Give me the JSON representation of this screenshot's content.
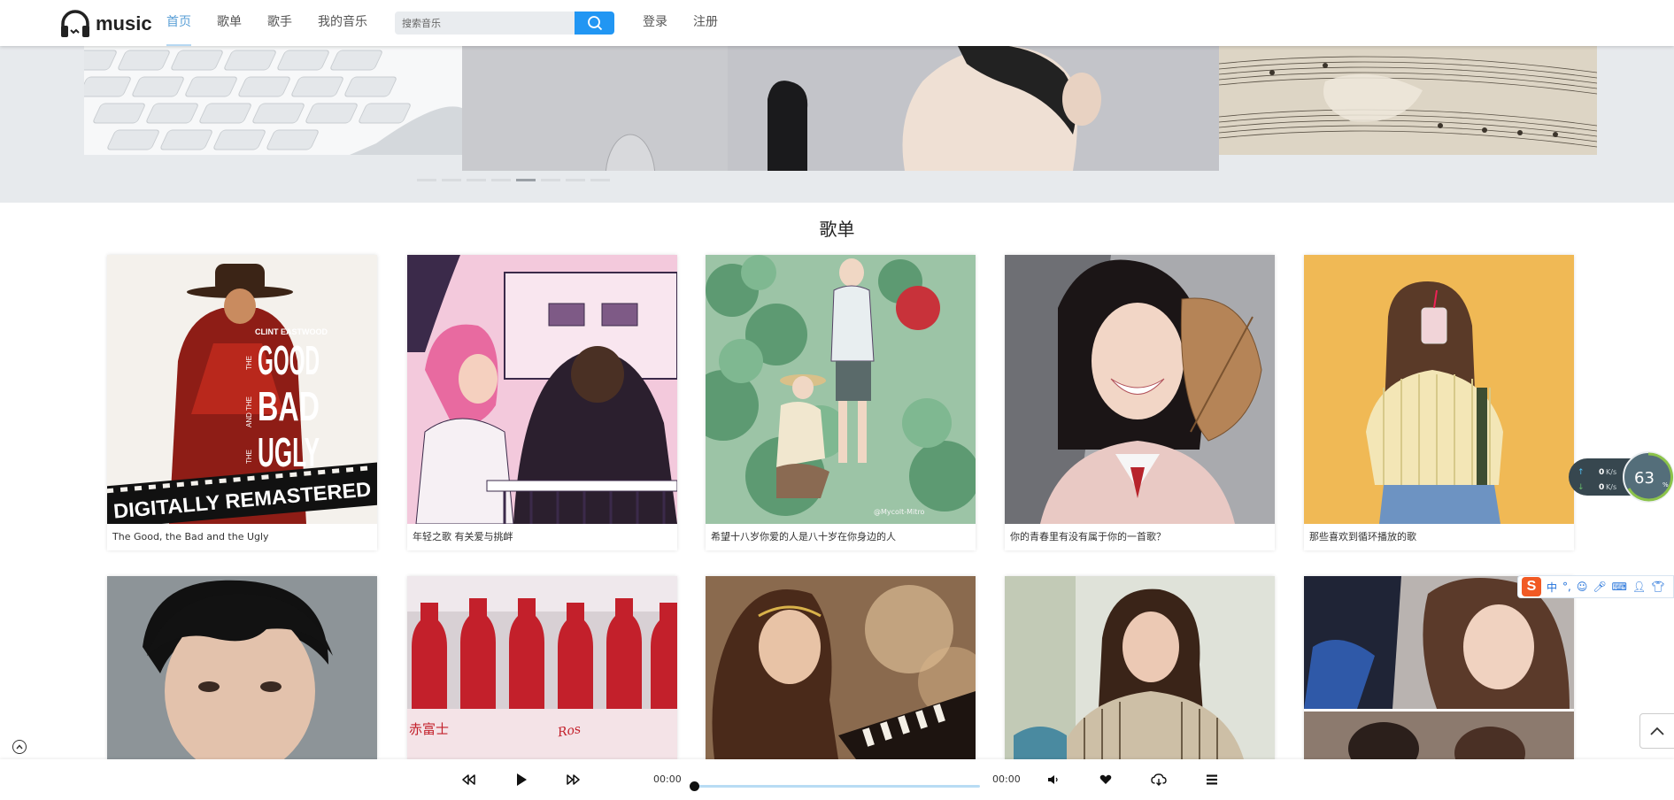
{
  "header": {
    "logo_text": "music",
    "nav": [
      {
        "label": "首页",
        "active": true
      },
      {
        "label": "歌单",
        "active": false
      },
      {
        "label": "歌手",
        "active": false
      },
      {
        "label": "我的音乐",
        "active": false
      }
    ],
    "search": {
      "placeholder": "搜索音乐",
      "value": ""
    },
    "auth": [
      {
        "label": "登录"
      },
      {
        "label": "注册"
      }
    ],
    "accent_color": "#2196f3",
    "active_nav_color": "#5a9fd6"
  },
  "carousel": {
    "slides": [
      "keyboard-photo",
      "singer-microphone-photo",
      "sheet-music-photo"
    ],
    "dot_count": 8,
    "active_dot": 4
  },
  "playlists": {
    "title": "歌单",
    "cards": [
      {
        "label": "The Good, the Bad and the Ugly",
        "poster": {
          "line1": "CLINT EASTWOOD",
          "line2": "GOOD",
          "line3": "BAD",
          "line4": "UGLY",
          "banner": "DIGITALLY REMASTERED",
          "side_a": "THE",
          "side_b": "AND THE",
          "side_c": "THE"
        }
      },
      {
        "label": "年轻之歌 有关爱与挑衅"
      },
      {
        "label": "希望十八岁你爱的人是八十岁在你身边的人",
        "watermark": "@Mycolt-Mitro"
      },
      {
        "label": "你的青春里有没有属于你的一首歌？"
      },
      {
        "label": "那些喜欢到循环播放的歌"
      },
      {
        "label": ""
      },
      {
        "label": "",
        "bottle_text": "赤富士"
      },
      {
        "label": ""
      },
      {
        "label": ""
      },
      {
        "label": ""
      }
    ]
  },
  "speed_widget": {
    "up": "0",
    "down": "0",
    "unit": "K/s",
    "percent": "63",
    "percent_sign": "%"
  },
  "ime_bar": {
    "logo": "S",
    "mode": "中",
    "punct": "°,"
  },
  "player": {
    "current_time": "00:00",
    "total_time": "00:00",
    "progress": 0
  }
}
